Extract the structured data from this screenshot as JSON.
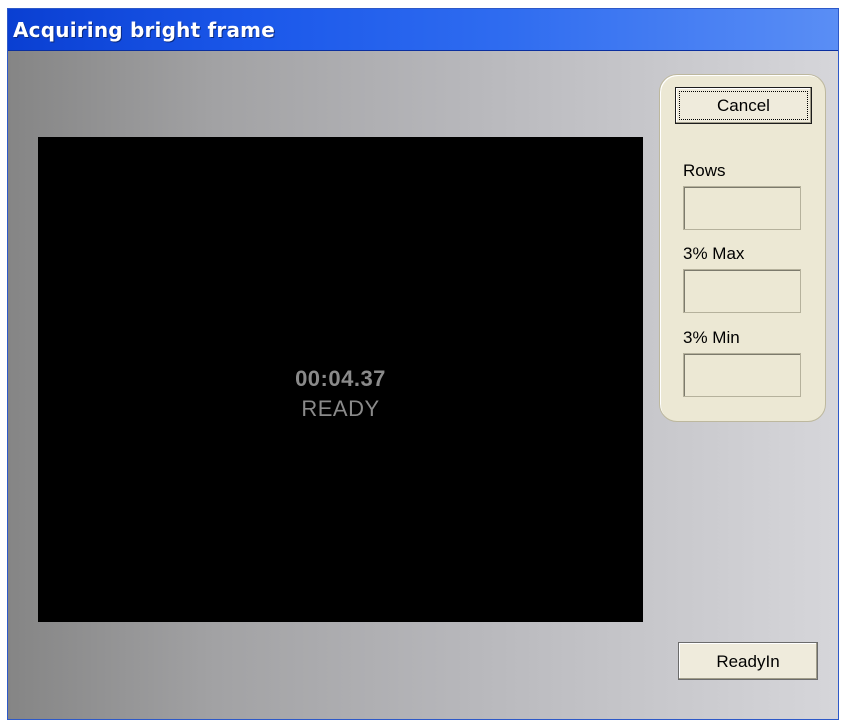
{
  "window": {
    "title": "Acquiring bright frame"
  },
  "video": {
    "timer": "00:04.37",
    "status": "READY"
  },
  "panel": {
    "cancel_label": "Cancel",
    "rows_label": "Rows",
    "rows_value": "",
    "max_label": "3% Max",
    "max_value": "",
    "min_label": "3% Min",
    "min_value": ""
  },
  "footer": {
    "readyin_label": "ReadyIn"
  },
  "colors": {
    "title_bar": "#1b58ea",
    "video_background": "#000000",
    "overlay_text": "#8a8a8a",
    "panel_background": "#ece8d4"
  }
}
